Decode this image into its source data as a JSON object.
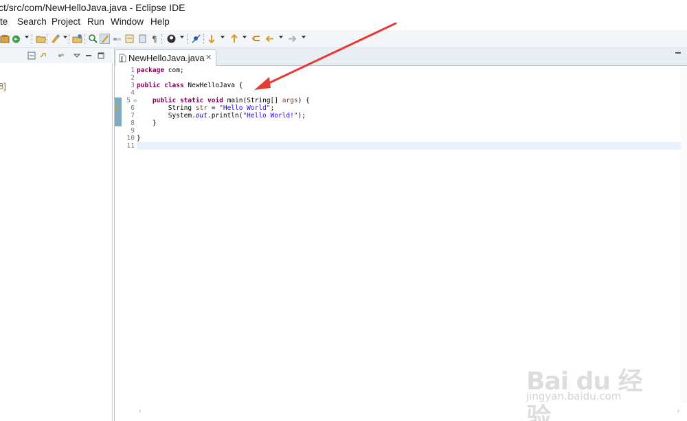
{
  "window": {
    "title": "ct/src/com/NewHelloJava.java - Eclipse IDE"
  },
  "menu": [
    "te",
    "Search",
    "Project",
    "Run",
    "Window",
    "Help"
  ],
  "toolbar": {
    "icons": [
      "new-java-package-icon",
      "debug-icon",
      "open-type-icon",
      "open-task-icon",
      "open-resource-icon",
      "search-icon",
      "mark-occurrences-icon",
      "toggle-breadcrumb-icon",
      "show-whitespace-icon",
      "block-selection-icon",
      "paragraph-icon",
      "profile-icon",
      "skip-breakpoints-icon",
      "next-annotation-icon",
      "previous-annotation-icon",
      "last-edit-location-icon",
      "back-icon",
      "forward-icon"
    ]
  },
  "left_pane": {
    "tree_fragment": "8]"
  },
  "editor": {
    "tab_label": "NewHelloJava.java",
    "tab_close": "✕",
    "lines": [
      {
        "no": "1",
        "text": "package com;"
      },
      {
        "no": "2",
        "text": ""
      },
      {
        "no": "3",
        "text": "public class NewHelloJava {"
      },
      {
        "no": "4",
        "text": ""
      },
      {
        "no": "5",
        "text": "    public static void main(String[] args) {"
      },
      {
        "no": "6",
        "text": "        String str = \"Hello World\";"
      },
      {
        "no": "7",
        "text": "        System.out.println(\"Hello World!\");"
      },
      {
        "no": "8",
        "text": "    }"
      },
      {
        "no": "9",
        "text": ""
      },
      {
        "no": "10",
        "text": "}"
      },
      {
        "no": "11",
        "text": ""
      }
    ]
  },
  "colors": {
    "keyword": "#7f0055",
    "string": "#2a00ff",
    "annotation_arrow": "#e53a35",
    "selection_line": "#e8f2fe"
  },
  "watermark": {
    "brand": "Bai du 经验",
    "url": "jingyan.baidu.com"
  }
}
